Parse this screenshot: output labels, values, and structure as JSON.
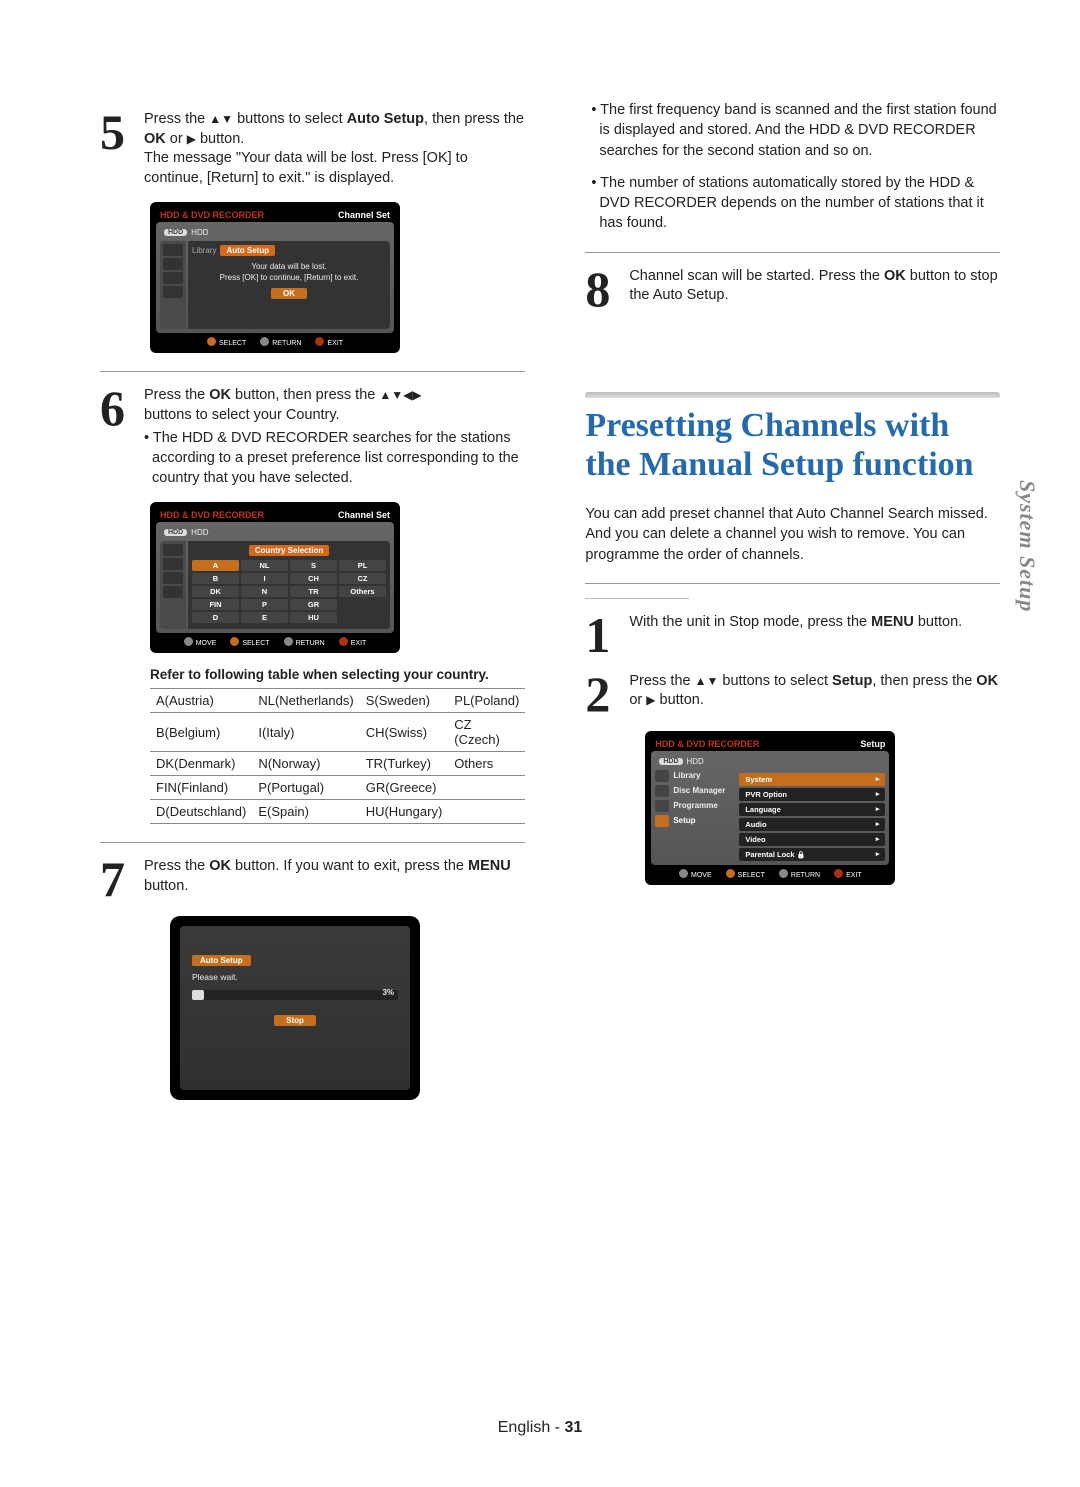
{
  "sidelabel": "System Setup",
  "footer": {
    "lang": "English",
    "sep": " - ",
    "page": "31"
  },
  "left": {
    "step5": {
      "num": "5",
      "t1a": "Press the ",
      "t1b": " buttons to select ",
      "bold1": "Auto Setup",
      "t1c": ", then press the ",
      "bold2": "OK",
      "t1d": " or ",
      "t1e": " button.",
      "t2": "The message \"Your data will be lost. Press [OK] to continue, [Return] to exit.\" is displayed."
    },
    "tv1": {
      "recorder": "HDD & DVD RECORDER",
      "channelset": "Channel Set",
      "hdd": "HDD",
      "library": "Library",
      "autoSetup": "Auto Setup",
      "msg1": "Your data will be lost.",
      "msg2": "Press [OK] to continue, [Return] to exit.",
      "ok": "OK",
      "f_select": "SELECT",
      "f_return": "RETURN",
      "f_exit": "EXIT"
    },
    "step6": {
      "num": "6",
      "t1a": "Press the ",
      "bold1": "OK",
      "t1b": " button, then press the ",
      "t1c": " buttons to select your Country.",
      "b1": "The HDD & DVD RECORDER searches for the stations according to a preset preference list corresponding to the country that you have selected."
    },
    "tv2": {
      "recorder": "HDD & DVD RECORDER",
      "channelset": "Channel Set",
      "hdd": "HDD",
      "head": "Country Selection",
      "grid": [
        "A",
        "NL",
        "S",
        "PL",
        "B",
        "I",
        "CH",
        "CZ",
        "DK",
        "N",
        "TR",
        "Others",
        "FIN",
        "P",
        "GR",
        "",
        "D",
        "E",
        "HU",
        ""
      ],
      "f_move": "MOVE",
      "f_select": "SELECT",
      "f_return": "RETURN",
      "f_exit": "EXIT"
    },
    "ctitle": "Refer to following table when selecting your country.",
    "ctable": {
      "rows": [
        [
          "A(Austria)",
          "NL(Netherlands)",
          "S(Sweden)",
          "PL(Poland)"
        ],
        [
          "B(Belgium)",
          "I(Italy)",
          "CH(Swiss)",
          "CZ (Czech)"
        ],
        [
          "DK(Denmark)",
          "N(Norway)",
          "TR(Turkey)",
          "Others"
        ],
        [
          "FIN(Finland)",
          "P(Portugal)",
          "GR(Greece)",
          ""
        ],
        [
          "D(Deutschland)",
          "E(Spain)",
          "HU(Hungary)",
          ""
        ]
      ]
    },
    "step7": {
      "num": "7",
      "t1a": "Press the ",
      "bold1": "OK",
      "t1b": " button. If you want to exit, press the ",
      "bold2": "MENU",
      "t1c": " button."
    },
    "scan": {
      "head": "Auto Setup",
      "wait": "Please wait.",
      "pct": "3%",
      "stop": "Stop"
    }
  },
  "right": {
    "bullets": {
      "b1": "• The first frequency band is scanned and the first station found is displayed and stored. And the HDD & DVD RECORDER searches for the second station and so on.",
      "b2": "• The number of stations automatically stored by the HDD & DVD RECORDER depends on the number of stations that it has found."
    },
    "step8": {
      "num": "8",
      "t1a": "Channel scan will be started. Press the ",
      "bold1": "OK",
      "t1b": " button to stop the Auto Setup."
    },
    "section_title_1": "Presetting Channels with",
    "section_title_2": "the Manual Setup function",
    "intro": "You can add preset channel that Auto Channel Search missed. And you can delete a channel you wish to remove. You can programme the order of channels.",
    "step1": {
      "num": "1",
      "t1a": "With the unit in Stop mode, press the ",
      "bold1": "MENU",
      "t1b": " button."
    },
    "step2": {
      "num": "2",
      "t1a": "Press the ",
      "t1b": " buttons to select ",
      "bold1": "Setup",
      "t1c": ", then press the ",
      "bold2": "OK",
      "t1d": " or ",
      "t1e": " button."
    },
    "tv3": {
      "recorder": "HDD & DVD RECORDER",
      "setup": "Setup",
      "hdd": "HDD",
      "side": [
        "Library",
        "Disc Manager",
        "Programme",
        "Setup"
      ],
      "menu": [
        "System",
        "PVR Option",
        "Language",
        "Audio",
        "Video",
        "Parental Lock"
      ],
      "f_move": "MOVE",
      "f_select": "SELECT",
      "f_return": "RETURN",
      "f_exit": "EXIT"
    }
  }
}
